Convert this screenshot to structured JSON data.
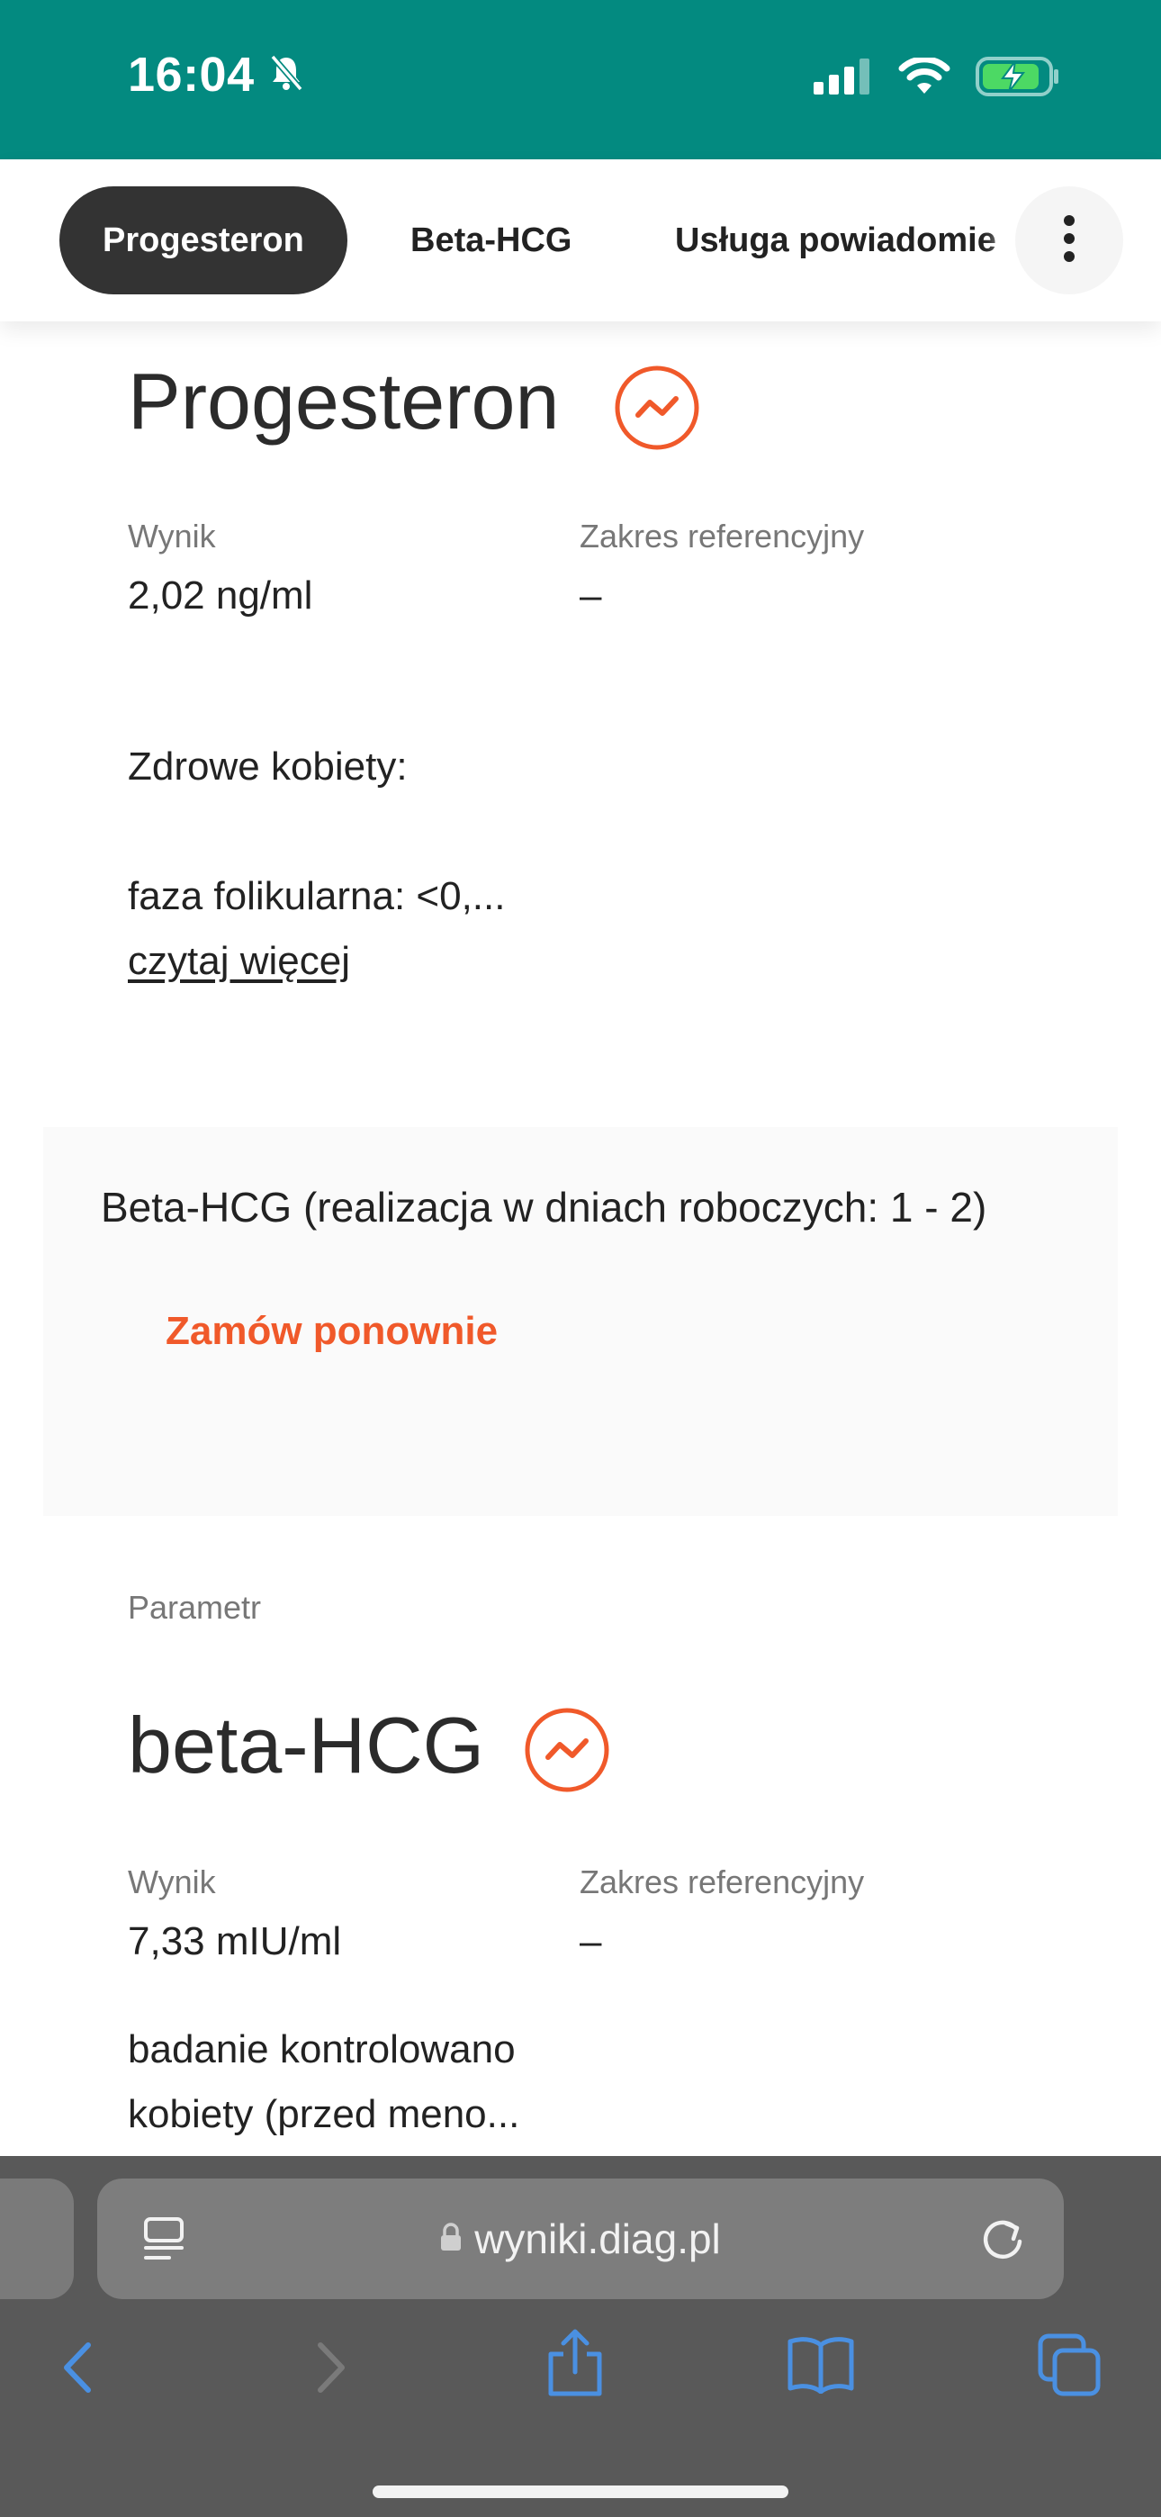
{
  "status_bar": {
    "time": "16:04",
    "background": "#038a80"
  },
  "tabs": [
    {
      "label": "Progesteron",
      "active": true
    },
    {
      "label": "Beta-HCG",
      "active": false
    },
    {
      "label": "Usługa powiadomie",
      "active": false
    }
  ],
  "progesteron": {
    "title": "Progesteron",
    "result_label": "Wynik",
    "result_value": "2,02 ng/ml",
    "reference_label": "Zakres referencyjny",
    "reference_value": "–",
    "note_line1": "Zdrowe kobiety:",
    "note_line2": "faza folikularna: <0,...",
    "read_more": "czytaj więcej"
  },
  "order": {
    "title": "Beta-HCG (realizacja w dniach roboczych: 1 - 2)",
    "reorder_label": "Zamów ponownie",
    "accent": "#f0592a"
  },
  "beta_hcg": {
    "parameter_label": "Parametr",
    "title": "beta-HCG",
    "result_label": "Wynik",
    "result_value": "7,33 mIU/ml",
    "reference_label": "Zakres referencyjny",
    "reference_value": "–",
    "note_line1": "badanie kontrolowano",
    "note_line2": "kobiety (przed meno..."
  },
  "browser": {
    "url": "wyniki.diag.pl",
    "icons": [
      "reader-icon",
      "lock-icon",
      "reload-icon",
      "back-icon",
      "forward-icon",
      "share-icon",
      "bookmarks-icon",
      "tabs-icon"
    ],
    "accent": "#4a90e2"
  }
}
